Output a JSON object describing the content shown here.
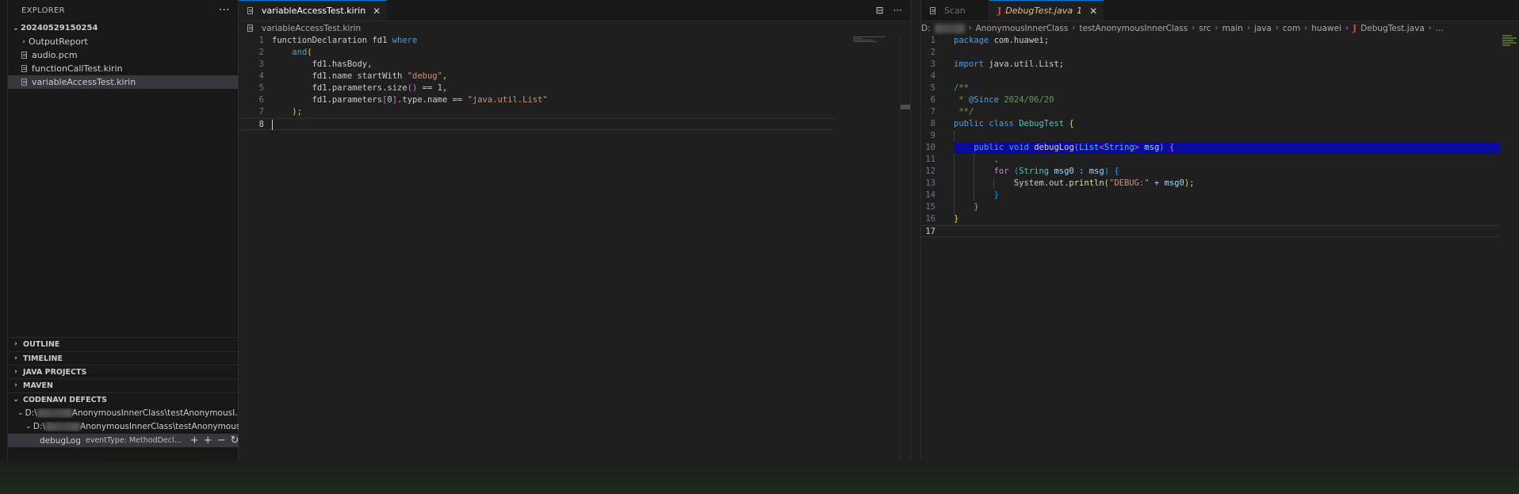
{
  "explorer": {
    "title": "EXPLORER",
    "more": "···",
    "root": "20240529150254",
    "items": [
      {
        "label": "OutputReport",
        "kind": "folder"
      },
      {
        "label": "audio.pcm",
        "kind": "file"
      },
      {
        "label": "functionCallTest.kirin",
        "kind": "file"
      },
      {
        "label": "variableAccessTest.kirin",
        "kind": "file",
        "selected": true
      }
    ]
  },
  "sections": {
    "outline": "OUTLINE",
    "timeline": "TIMELINE",
    "java_projects": "JAVA PROJECTS",
    "maven": "MAVEN",
    "codenavi": "CODENAVI DEFECTS"
  },
  "defects": {
    "row1_prefix": "D:\\",
    "row1_suffix": "AnonymousInnerClass\\testAnonymousInn...",
    "row2_prefix": "D:\\",
    "row2_suffix": "AnonymousInnerClass\\testAnonymousIn...",
    "row3_name": "debugLog",
    "row3_desc": "eventType: MethodDeclarati..."
  },
  "left_editor": {
    "tab": "variableAccessTest.kirin",
    "breadcrumb": "variableAccessTest.kirin",
    "line_numbers": [
      "1",
      "2",
      "3",
      "4",
      "5",
      "6",
      "7",
      "8"
    ],
    "tokens": {
      "l1a": "functionDeclaration fd1 ",
      "l1b": "where",
      "l2": "and",
      "l3": "fd1.hasBody,",
      "l4a": "fd1.name startWith ",
      "l4b": "\"debug\"",
      "l5a": "fd1.parameters.size",
      "l5b": " == ",
      "l5c": "1",
      "l6a": "fd1.parameters",
      "l6b": "0",
      "l6c": ".type.name == ",
      "l6d": "\"java.util.List\""
    }
  },
  "right_editor": {
    "tab_inactive": "Scan",
    "tab_active": "DebugTest.java",
    "tab_badge": "1",
    "breadcrumb": {
      "drive": "D:",
      "parts": [
        "AnonymousInnerClass",
        "testAnonymousInnerClass",
        "src",
        "main",
        "java",
        "com",
        "huawei"
      ],
      "file": "DebugTest.java",
      "tail": "..."
    },
    "line_numbers": [
      "1",
      "2",
      "3",
      "4",
      "5",
      "6",
      "7",
      "8",
      "9",
      "10",
      "11",
      "12",
      "13",
      "14",
      "15",
      "16",
      "17"
    ],
    "tokens": {
      "l1a": "package",
      "l1b": " com.huawei;",
      "l3a": "import",
      "l3b": " java.util.List;",
      "l5": "/**",
      "l6a": " * ",
      "l6b": "@Since",
      "l6c": " 2024/06/20",
      "l7": " **/",
      "l8a": "public",
      "l8b": "class",
      "l8c": " DebugTest ",
      "l10a": "public",
      "l10b": "void",
      "l10c": "debugLog",
      "l10d": "List",
      "l10e": "String",
      "l10f": " msg",
      "l11": ",",
      "l12a": "for",
      "l12b": "String",
      "l12c": " msg0 : msg",
      "l13a": "System.out.",
      "l13b": "println",
      "l13c": "\"DEBUG:\"",
      "l13d": " + msg0"
    }
  }
}
